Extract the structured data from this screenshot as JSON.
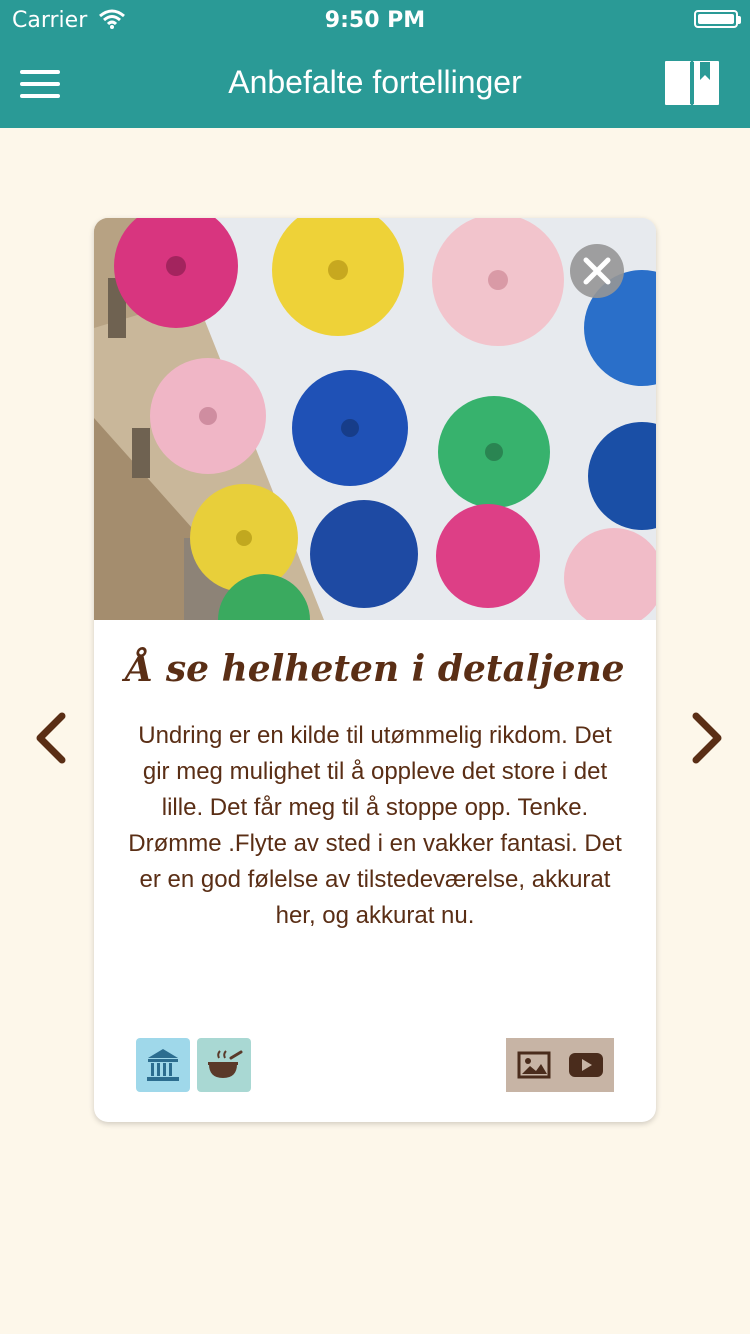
{
  "status_bar": {
    "carrier": "Carrier",
    "time": "9:50 PM"
  },
  "nav": {
    "title": "Anbefalte fortellinger"
  },
  "story": {
    "title": "Å se helheten i detaljene",
    "body": "Undring er en kilde til utømmelig rikdom. Det gir meg mulighet til å oppleve det store i det lille. Det får meg til å stoppe opp. Tenke. Drømme .Flyte av sted i en vakker fantasi. Det er en god følelse av tilstedeværelse, akkurat her, og akkurat nu."
  },
  "colors": {
    "header": "#2a9a96",
    "background": "#fdf7ea",
    "text_brown": "#5a2e15",
    "tag_museum": "#9fd8ea",
    "tag_food": "#a9d8d3",
    "media_box": "#c7b4a5"
  },
  "icons": {
    "menu": "hamburger-icon",
    "bookmarks": "book-bookmark-icon",
    "close": "close-circle-icon",
    "tag_museum": "museum-icon",
    "tag_food": "cooking-pot-icon",
    "media_image": "image-icon",
    "media_video": "play-video-icon",
    "prev": "chevron-left-icon",
    "next": "chevron-right-icon"
  }
}
